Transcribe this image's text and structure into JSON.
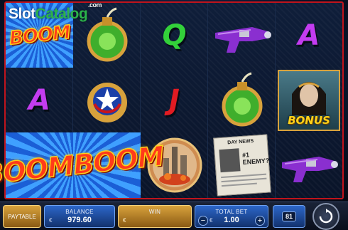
{
  "watermark": {
    "slot": "Slot",
    "catalog": "Catalog",
    "com": ".com"
  },
  "symbols": {
    "boom_single": "BOOM",
    "boom_double": "BOOMBOOM",
    "letter_a": "A",
    "letter_q": "Q",
    "letter_j": "J",
    "bonus": "BONUS",
    "newspaper_header": "DAY NEWS",
    "newspaper_headline": "#1 ENEMY?"
  },
  "colors": {
    "letter_a": "#c33cf0",
    "letter_q": "#33d13a",
    "letter_j": "#e11b22",
    "frame": "#c0141c"
  },
  "bottom_bar": {
    "paytable_label": "PAYTABLE",
    "balance_label": "BALANCE",
    "balance_currency": "€",
    "balance_value": "979.60",
    "win_label": "WIN",
    "win_currency": "€",
    "total_bet_label": "TOTAL BET",
    "total_bet_currency": "€",
    "total_bet_value": "1.00",
    "bet_minus": "−",
    "bet_plus": "+",
    "autoplay_value": "81",
    "spin_icon": "spin-arrows-icon",
    "autoplay_icon": "autoplay-icon"
  }
}
